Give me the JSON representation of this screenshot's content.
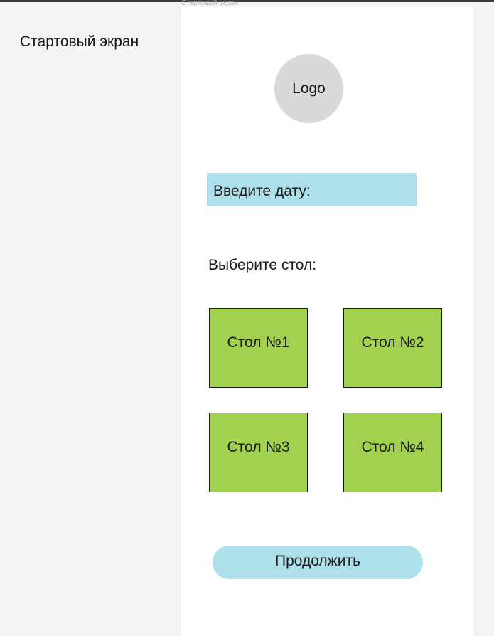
{
  "canvas": {
    "section_title": "Стартовый экран",
    "frame_label": "Стартовый экран"
  },
  "screen": {
    "logo_text": "Logo",
    "date_input": {
      "placeholder": "Введите дату:"
    },
    "choose_table_label": "Выберите стол:",
    "tables": [
      {
        "label": "Стол №1"
      },
      {
        "label": "Стол №2"
      },
      {
        "label": "Стол №3"
      },
      {
        "label": "Стол №4"
      }
    ],
    "continue_button": "Продолжить"
  },
  "colors": {
    "canvas_background": "#f4f4f4",
    "frame_background": "#ffffff",
    "logo_fill": "#d9d9d9",
    "input_fill": "#ade0eb",
    "table_fill": "#a1d14f",
    "button_fill": "#ade0eb"
  }
}
